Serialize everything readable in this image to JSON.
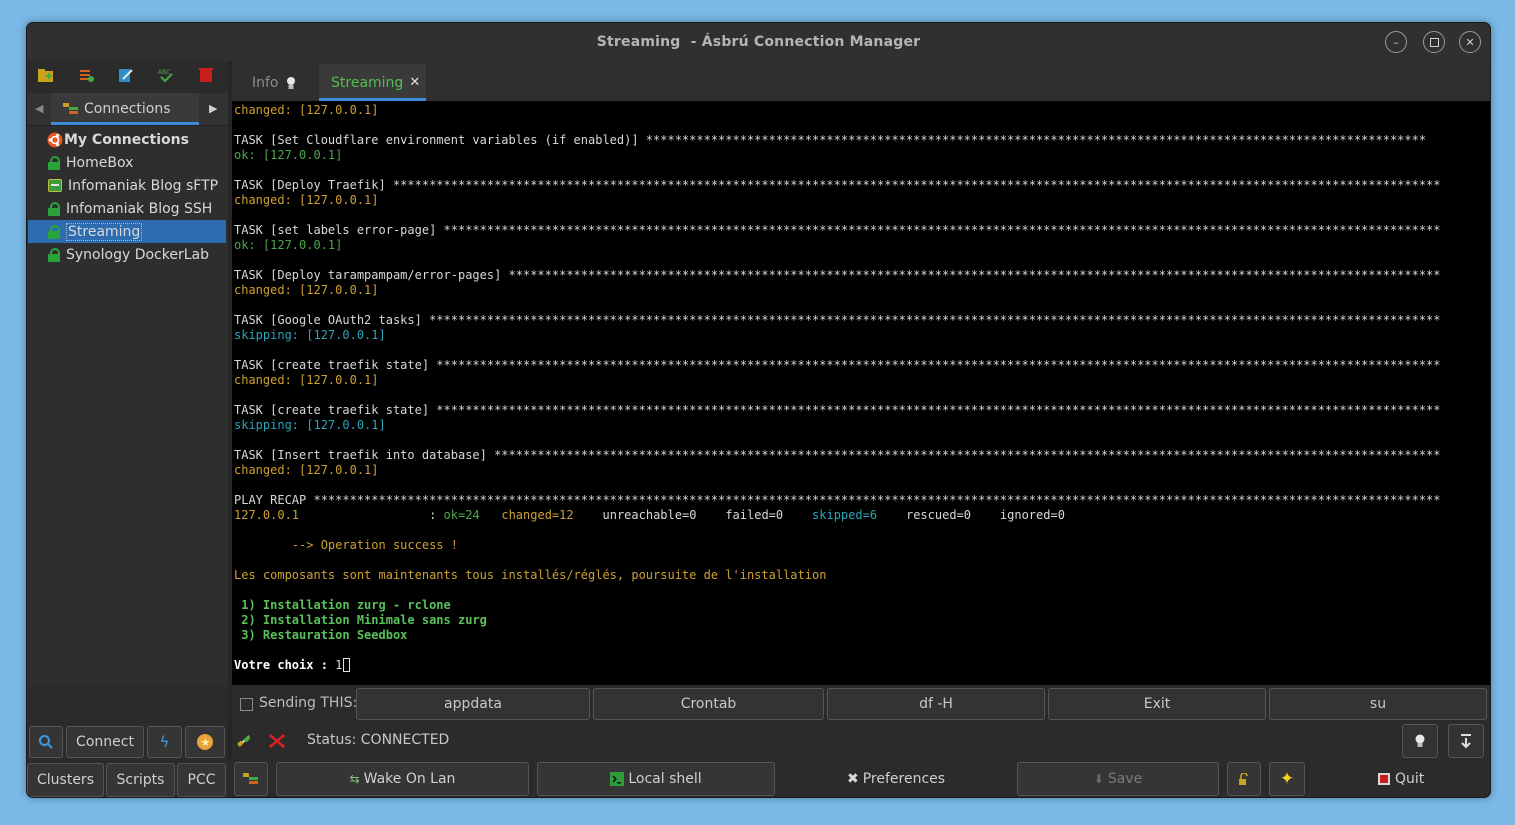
{
  "window": {
    "title": "Streaming  - Ásbrú Connection Manager"
  },
  "sidebar": {
    "tab_label": "Connections",
    "tree": [
      {
        "label": "My Connections",
        "kind": "root"
      },
      {
        "label": "HomeBox",
        "kind": "ssh"
      },
      {
        "label": "Infomaniak Blog sFTP",
        "kind": "sftp"
      },
      {
        "label": "Infomaniak Blog SSH",
        "kind": "ssh"
      },
      {
        "label": "Streaming",
        "kind": "ssh",
        "selected": true
      },
      {
        "label": "Synology DockerLab",
        "kind": "ssh"
      }
    ],
    "connect_label": "Connect",
    "bottom_tabs": [
      "Clusters",
      "Scripts",
      "PCC"
    ]
  },
  "tabs": [
    {
      "label": "Info"
    },
    {
      "label": "Streaming",
      "active": true
    }
  ],
  "terminal": {
    "lines": [
      {
        "text": "changed: [127.0.0.1]",
        "color": "yellow"
      },
      {
        "text": "",
        "color": "white"
      },
      {
        "text": "TASK [Set Cloudflare environment variables (if enabled)] ************************************************************************************************************",
        "color": "white"
      },
      {
        "text": "ok: [127.0.0.1]",
        "color": "green"
      },
      {
        "text": "",
        "color": "white"
      },
      {
        "text": "TASK [Deploy Traefik] *************************************************************************************************************************************************",
        "color": "white"
      },
      {
        "text": "changed: [127.0.0.1]",
        "color": "yellow"
      },
      {
        "text": "",
        "color": "white"
      },
      {
        "text": "TASK [set labels error-page] ******************************************************************************************************************************************",
        "color": "white"
      },
      {
        "text": "ok: [127.0.0.1]",
        "color": "green"
      },
      {
        "text": "",
        "color": "white"
      },
      {
        "text": "TASK [Deploy tarampampam/error-pages] *********************************************************************************************************************************",
        "color": "white"
      },
      {
        "text": "changed: [127.0.0.1]",
        "color": "yellow"
      },
      {
        "text": "",
        "color": "white"
      },
      {
        "text": "TASK [Google OAuth2 tasks] ********************************************************************************************************************************************",
        "color": "white"
      },
      {
        "text": "skipping: [127.0.0.1]",
        "color": "cyan"
      },
      {
        "text": "",
        "color": "white"
      },
      {
        "text": "TASK [create traefik state] *******************************************************************************************************************************************",
        "color": "white"
      },
      {
        "text": "changed: [127.0.0.1]",
        "color": "yellow"
      },
      {
        "text": "",
        "color": "white"
      },
      {
        "text": "TASK [create traefik state] *******************************************************************************************************************************************",
        "color": "white"
      },
      {
        "text": "skipping: [127.0.0.1]",
        "color": "cyan"
      },
      {
        "text": "",
        "color": "white"
      },
      {
        "text": "TASK [Insert traefik into database] ***********************************************************************************************************************************",
        "color": "white"
      },
      {
        "text": "changed: [127.0.0.1]",
        "color": "yellow"
      },
      {
        "text": "",
        "color": "white"
      },
      {
        "text": "PLAY RECAP ************************************************************************************************************************************************************",
        "color": "white"
      },
      {
        "recap": true
      },
      {
        "text": "",
        "color": "white"
      },
      {
        "text": "        --> Operation success !",
        "color": "yellow"
      },
      {
        "text": "",
        "color": "white"
      },
      {
        "text": "Les composants sont maintenants tous installés/réglés, poursuite de l'installation",
        "color": "yellow"
      },
      {
        "text": "",
        "color": "white"
      },
      {
        "text": " 1) Installation zurg - rclone",
        "color": "bgreen"
      },
      {
        "text": " 2) Installation Minimale sans zurg",
        "color": "bgreen"
      },
      {
        "text": " 3) Restauration Seedbox",
        "color": "bgreen"
      },
      {
        "text": "",
        "color": "white"
      },
      {
        "prompt": true
      }
    ],
    "recap": {
      "host": "127.0.0.1",
      "sep": "                  : ",
      "ok": "ok=24",
      "changed": "changed=12",
      "unreachable": "unreachable=0",
      "failed": "failed=0",
      "skipped": "skipped=6",
      "rescued": "rescued=0",
      "ignored": "ignored=0"
    },
    "prompt": {
      "label": "Votre choix : ",
      "input": "1"
    }
  },
  "sendbar": {
    "label": "Sending THIS:",
    "macros": [
      "appdata",
      "Crontab",
      "df -H",
      "Exit",
      "su"
    ]
  },
  "status": {
    "text": "Status: CONNECTED"
  },
  "bottombar": {
    "wake_on_lan": "Wake On Lan",
    "local_shell": "Local shell",
    "preferences": "Preferences",
    "save": "Save",
    "quit": "Quit"
  },
  "colors": {
    "terminal_bg": "#000000",
    "accent": "#3b8ad9",
    "selected": "#2d6cb0",
    "green": "#4ea74e",
    "yellow": "#cda033",
    "cyan": "#2aa4b8"
  }
}
